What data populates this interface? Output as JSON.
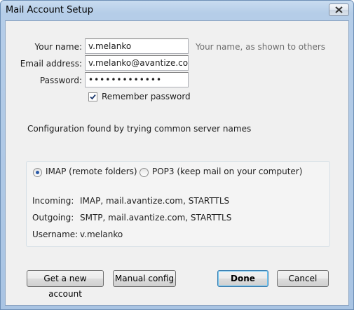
{
  "window": {
    "title": "Mail Account Setup"
  },
  "form": {
    "name_label": "Your name:",
    "name_value": "v.melanko",
    "name_hint": "Your name, as shown to others",
    "email_label": "Email address:",
    "email_value": "v.melanko@avantize.com",
    "password_label": "Password:",
    "password_value": "•••••••••••••",
    "remember_label": "Remember password",
    "remember_checked": true
  },
  "status_text": "Configuration found by trying common server names",
  "protocol": {
    "imap_label": "IMAP (remote folders)",
    "pop3_label": "POP3 (keep mail on your computer)",
    "selected": "IMAP"
  },
  "details": {
    "incoming_label": "Incoming:",
    "incoming_value": "IMAP, mail.avantize.com, STARTTLS",
    "outgoing_label": "Outgoing:",
    "outgoing_value": "SMTP, mail.avantize.com, STARTTLS",
    "username_label": "Username:",
    "username_value": "v.melanko"
  },
  "buttons": {
    "new_account": "Get a new account",
    "manual_config": "Manual config",
    "done": "Done",
    "cancel": "Cancel"
  },
  "icons": {
    "close": "close-icon",
    "checkmark": "checkmark-icon"
  }
}
